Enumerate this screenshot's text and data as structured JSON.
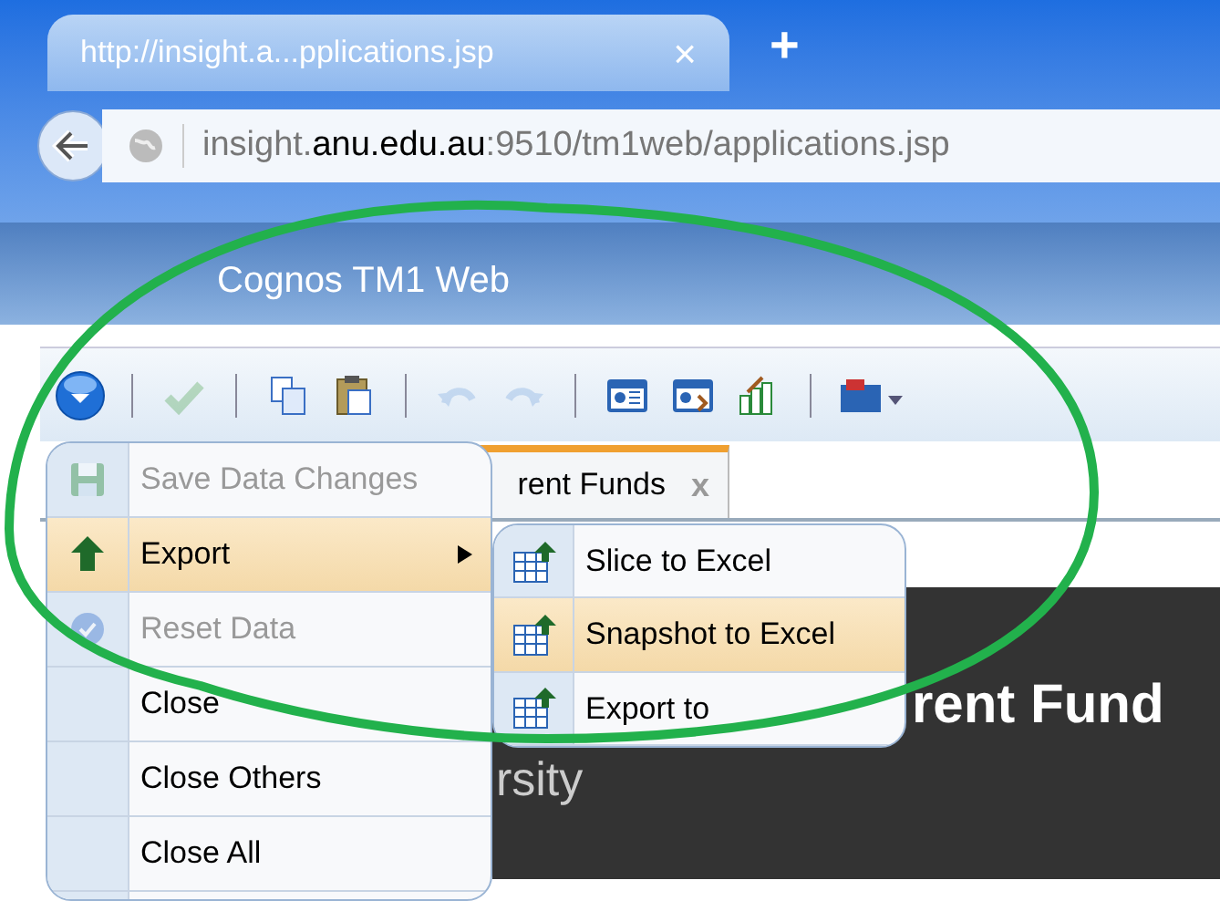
{
  "browser_tab": {
    "title": "http://insight.a...pplications.jsp",
    "close": "×",
    "new_tab": "+"
  },
  "address": {
    "prefix": "insight.",
    "host": "anu.edu.au",
    "suffix": ":9510/tm1web/applications.jsp"
  },
  "app_title": "Cognos TM1 Web",
  "toolbar": [
    {
      "kind": "menu",
      "disabled": false
    },
    {
      "kind": "separator"
    },
    {
      "kind": "check",
      "disabled": true
    },
    {
      "kind": "separator"
    },
    {
      "kind": "copy",
      "disabled": false
    },
    {
      "kind": "paste",
      "disabled": false
    },
    {
      "kind": "separator"
    },
    {
      "kind": "undo",
      "disabled": true
    },
    {
      "kind": "redo",
      "disabled": true
    },
    {
      "kind": "separator"
    },
    {
      "kind": "grid",
      "disabled": false
    },
    {
      "kind": "grid2",
      "disabled": false
    },
    {
      "kind": "chart",
      "disabled": false
    },
    {
      "kind": "separator"
    },
    {
      "kind": "toolbox",
      "disabled": false
    }
  ],
  "document_tab": {
    "label": "rent Funds",
    "close": "x"
  },
  "content": {
    "heading": "rent Fund",
    "subtitle": "rsity"
  },
  "menu": [
    {
      "label": "Save Data Changes",
      "kind": "save",
      "disabled": true,
      "selected": false,
      "submenu": false
    },
    {
      "label": "Export",
      "kind": "export",
      "disabled": false,
      "selected": true,
      "submenu": true
    },
    {
      "label": "Reset Data",
      "kind": "reset",
      "disabled": true,
      "selected": false,
      "submenu": false
    },
    {
      "label": "Close",
      "kind": "plain",
      "disabled": false,
      "selected": false,
      "submenu": false
    },
    {
      "label": "Close Others",
      "kind": "plain",
      "disabled": false,
      "selected": false,
      "submenu": false
    },
    {
      "label": "Close All",
      "kind": "plain",
      "disabled": false,
      "selected": false,
      "submenu": false
    }
  ],
  "submenu": [
    {
      "label": "Slice to Excel",
      "selected": false
    },
    {
      "label": "Snapshot to Excel",
      "selected": true
    },
    {
      "label": "Export to",
      "selected": false
    }
  ]
}
